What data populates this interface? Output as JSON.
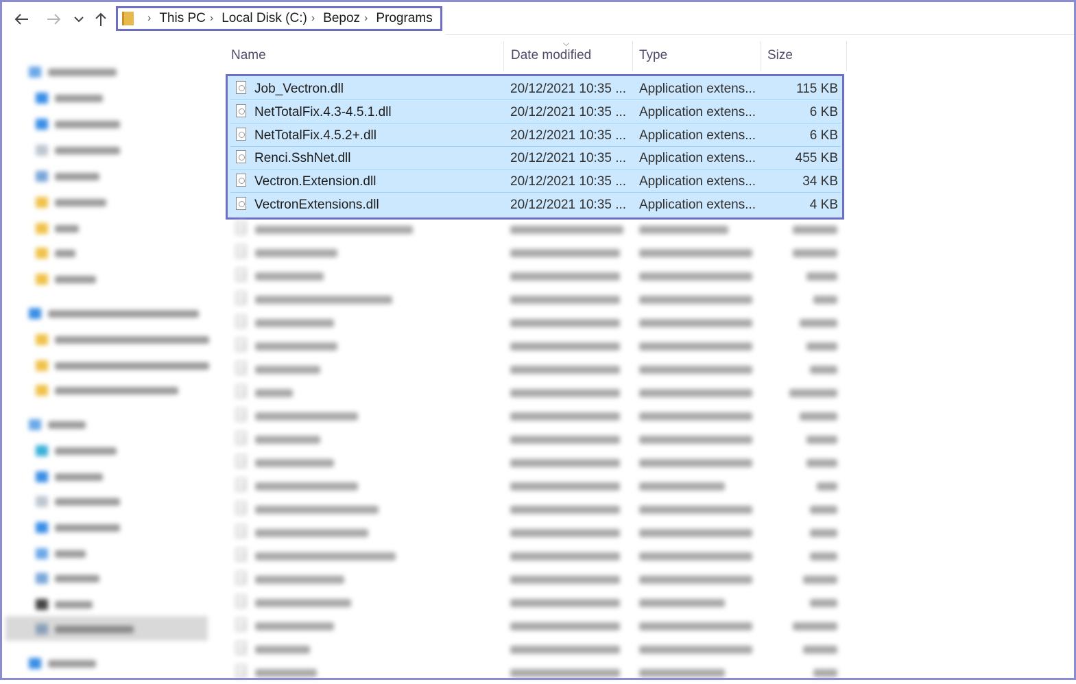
{
  "breadcrumb": {
    "items": [
      "This PC",
      "Local Disk (C:)",
      "Bepoz",
      "Programs"
    ]
  },
  "columns": {
    "name": "Name",
    "date": "Date modified",
    "type": "Type",
    "size": "Size"
  },
  "files": [
    {
      "name": "Job_Vectron.dll",
      "date": "20/12/2021 10:35 ...",
      "type": "Application extens...",
      "size": "115 KB"
    },
    {
      "name": "NetTotalFix.4.3-4.5.1.dll",
      "date": "20/12/2021 10:35 ...",
      "type": "Application extens...",
      "size": "6 KB"
    },
    {
      "name": "NetTotalFix.4.5.2+.dll",
      "date": "20/12/2021 10:35 ...",
      "type": "Application extens...",
      "size": "6 KB"
    },
    {
      "name": "Renci.SshNet.dll",
      "date": "20/12/2021 10:35 ...",
      "type": "Application extens...",
      "size": "455 KB"
    },
    {
      "name": "Vectron.Extension.dll",
      "date": "20/12/2021 10:35 ...",
      "type": "Application extens...",
      "size": "34 KB"
    },
    {
      "name": "VectronExtensions.dll",
      "date": "20/12/2021 10:35 ...",
      "type": "Application extens...",
      "size": "4 KB"
    }
  ],
  "icons": {
    "back": "back-arrow-icon",
    "forward": "forward-arrow-icon",
    "recent": "chevron-down-icon",
    "up": "up-arrow-icon",
    "folder": "folder-icon",
    "file": "dll-file-icon"
  },
  "colors": {
    "selection": "#cce8ff",
    "highlight_border": "#6d6fc6",
    "frame_border": "#8a8ccf"
  }
}
